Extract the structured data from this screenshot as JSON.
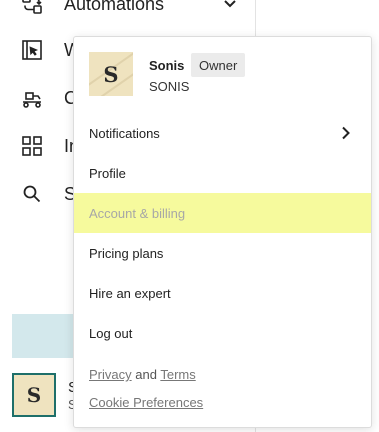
{
  "sidebar": {
    "items": [
      {
        "label": "Automations",
        "icon": "automation-icon",
        "has_chevron": true
      },
      {
        "label": "W",
        "icon": "cursor-window-icon"
      },
      {
        "label": "C",
        "icon": "conveyor-icon"
      },
      {
        "label": "In",
        "icon": "grid-icon"
      },
      {
        "label": "S",
        "icon": "search-icon"
      }
    ],
    "account": {
      "avatar_letter": "S",
      "name": "S",
      "sub": "S"
    }
  },
  "menu": {
    "user": {
      "avatar_letter": "S",
      "name": "Sonis",
      "role": "Owner",
      "org": "SONIS"
    },
    "items": [
      {
        "label": "Notifications",
        "has_submenu": true
      },
      {
        "label": "Profile"
      },
      {
        "label": "Account & billing",
        "highlighted": true
      },
      {
        "label": "Pricing plans"
      },
      {
        "label": "Hire an expert"
      },
      {
        "label": "Log out"
      }
    ],
    "footer": {
      "privacy": "Privacy",
      "and": "and",
      "terms": "Terms",
      "cookie": "Cookie Preferences"
    }
  },
  "colors": {
    "highlight": "#f6fa9d",
    "sidebar_active": "#d3e8ec",
    "avatar_border": "#1e6f6a",
    "avatar_bg": "#efe3bf"
  }
}
